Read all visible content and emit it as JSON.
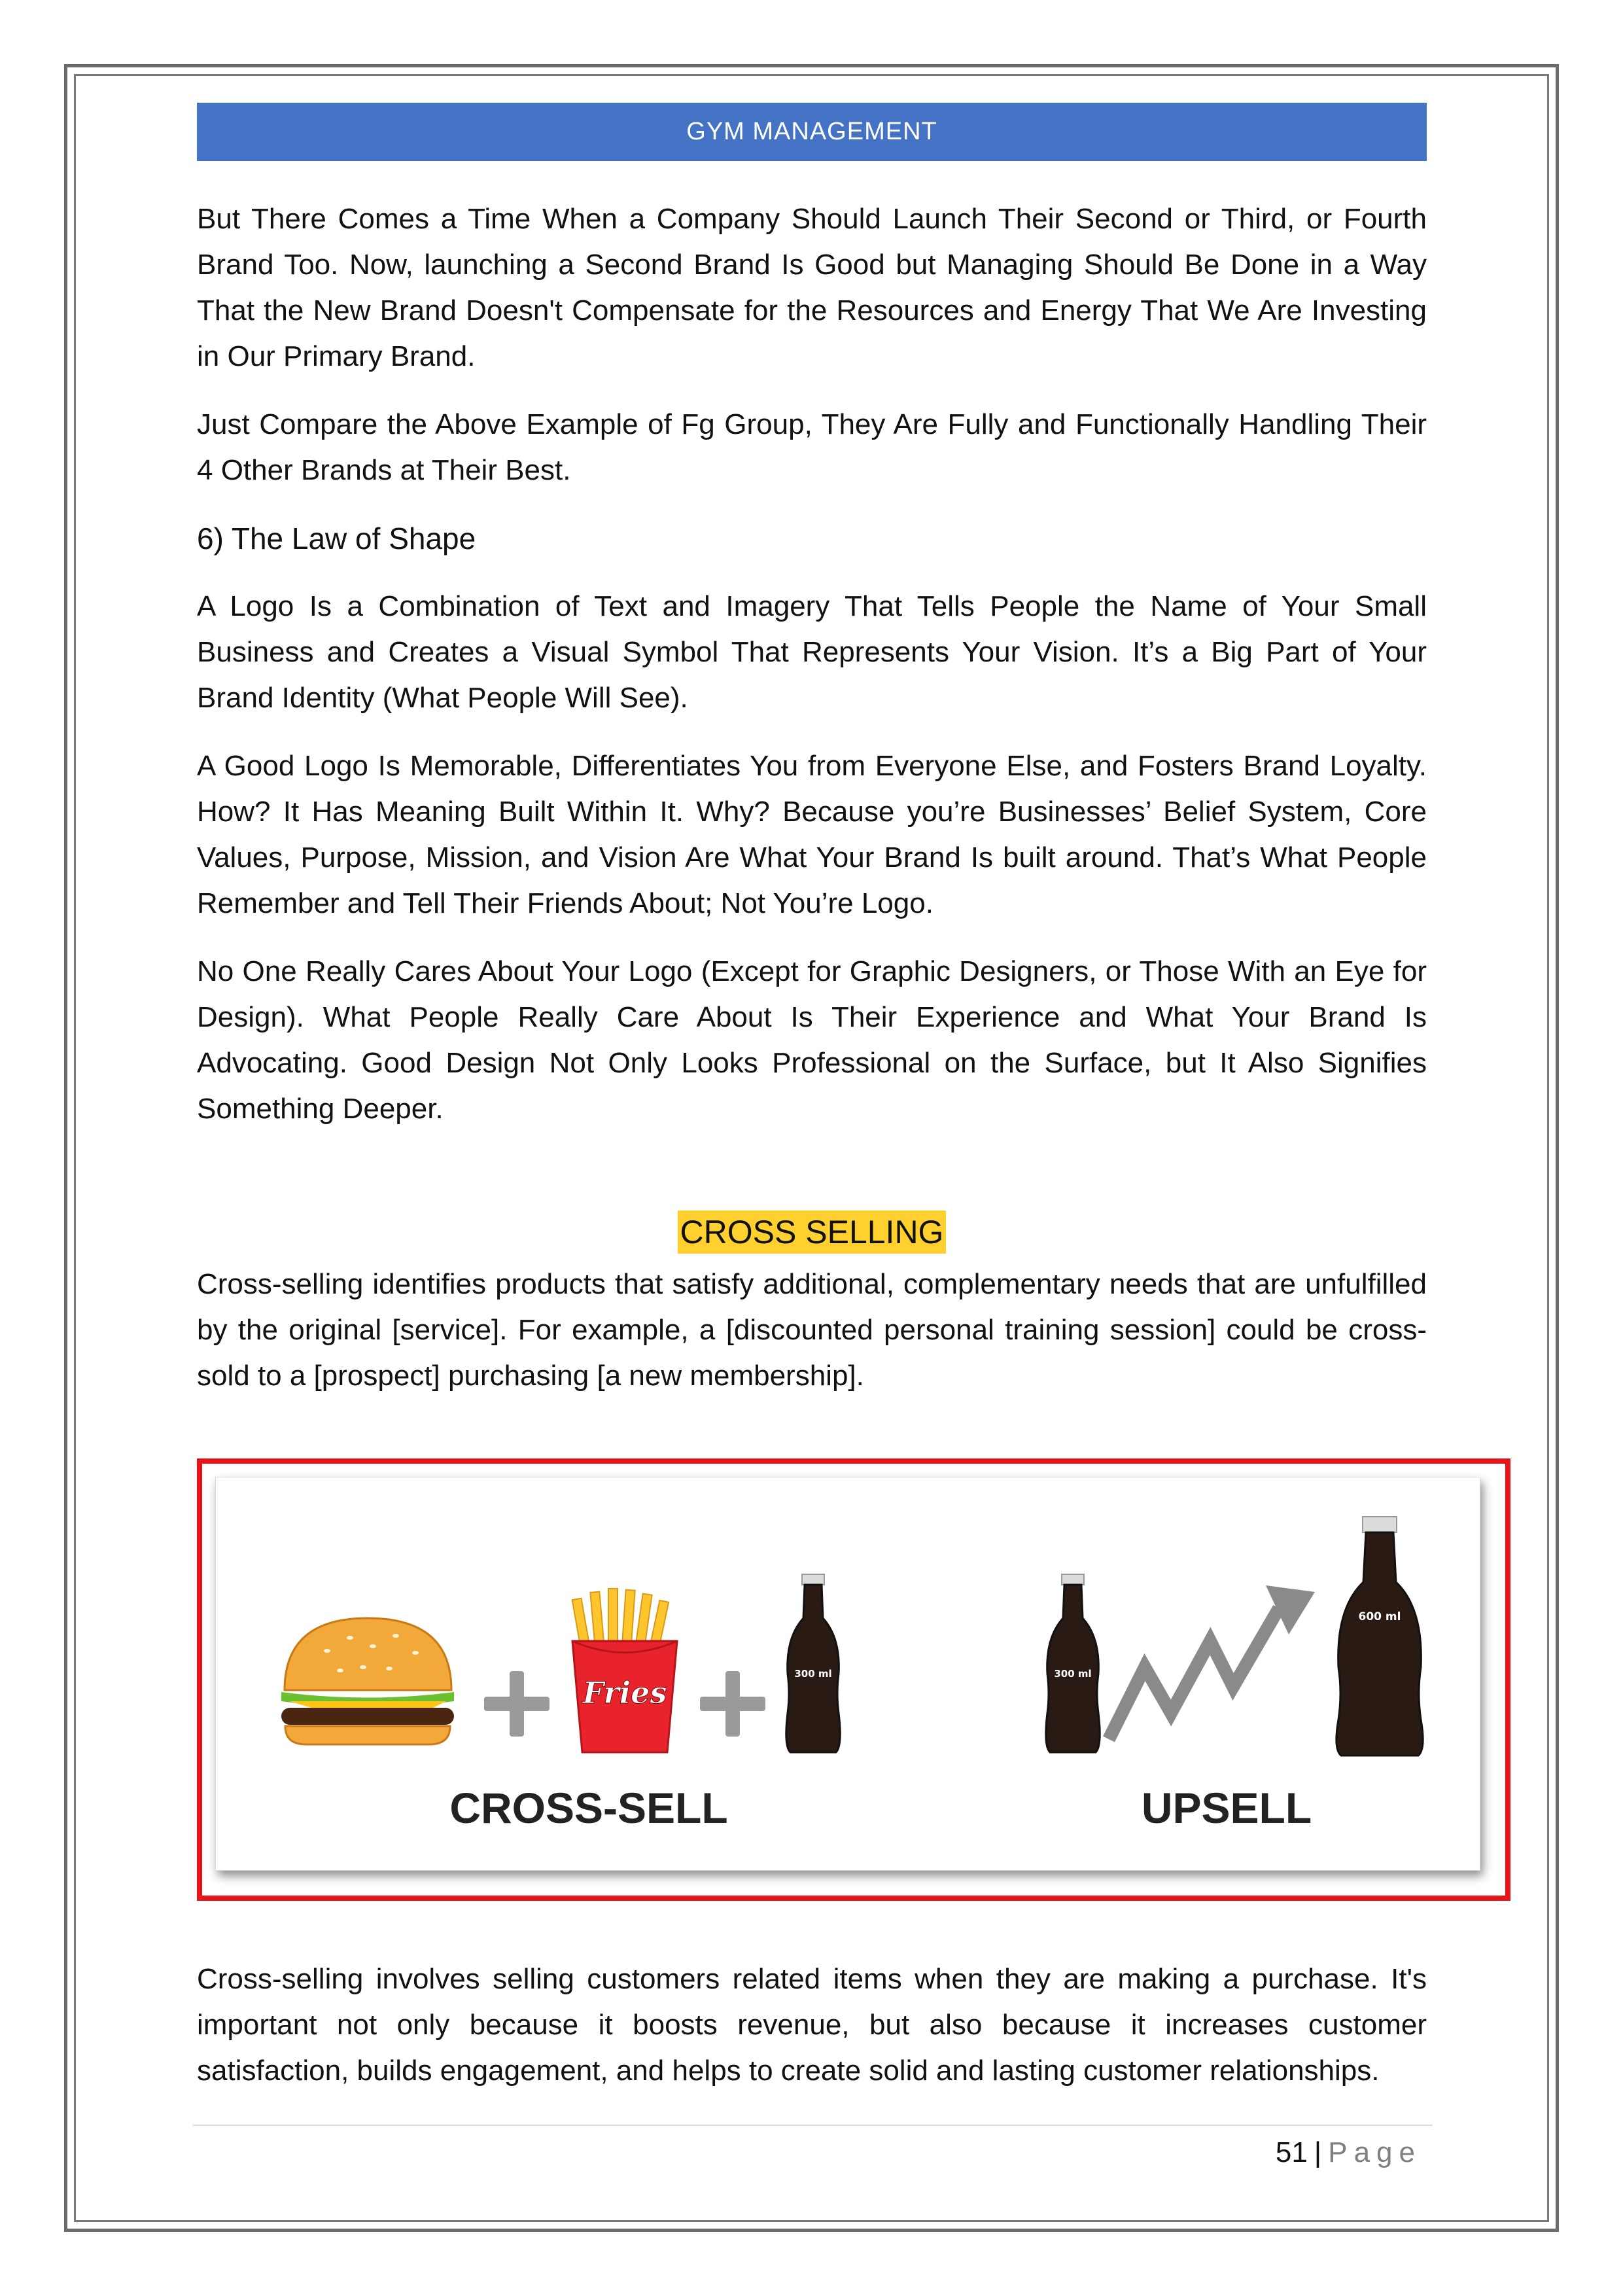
{
  "header": {
    "title": "GYM MANAGEMENT"
  },
  "paragraphs_top": [
    "But There Comes a Time When a Company Should Launch Their Second or Third, or Fourth Brand Too. Now, launching a Second Brand Is Good but Managing Should Be Done in a Way That the New Brand Doesn't Compensate for the Resources and Energy That We Are Investing in Our Primary Brand.",
    "Just Compare the Above Example of Fg Group, They Are Fully and Functionally Handling Their 4 Other Brands at Their Best."
  ],
  "subheading": "6) The Law of Shape",
  "paragraphs_shape": [
    "A Logo Is a Combination of Text and Imagery That Tells People the Name of Your Small Business and Creates a Visual Symbol That Represents Your Vision. It’s a Big Part of Your Brand Identity (What People Will See).",
    "A Good Logo Is Memorable, Differentiates You from Everyone Else, and Fosters Brand Loyalty. How? It Has Meaning Built Within It. Why? Because you’re Businesses’ Belief System, Core Values, Purpose, Mission, and Vision Are What Your Brand Is built around. That’s What People Remember and Tell Their Friends About; Not You’re Logo.",
    "No One Really Cares About Your Logo (Except for Graphic Designers, or Those With an Eye for Design). What People Really Care About Is Their Experience and What Your Brand Is Advocating. Good Design Not Only Looks Professional on the Surface, but It Also Signifies Something Deeper."
  ],
  "section_title": "CROSS SELLING",
  "cross_selling_intro": "Cross-selling identifies products that satisfy additional, complementary needs that are unfulfilled by the original [service]. For example, a [discounted personal training session] could be cross-sold to a [prospect] purchasing [a new membership].",
  "figure": {
    "fries_label": "Fries",
    "small_bottle_label": "300 ml",
    "large_bottle_label": "600 ml",
    "cross_sell_label": "CROSS-SELL",
    "upsell_label": "UPSELL",
    "frame_color": "#e8141a"
  },
  "cross_selling_body": "Cross-selling involves selling customers related items when they are making a purchase. It's important not only because it boosts revenue, but also because it increases customer satisfaction, builds engagement, and helps to create solid and lasting customer relationships.",
  "footer": {
    "page_number": "51",
    "separator": "|",
    "page_word": "Page"
  },
  "colors": {
    "header_bg": "#4472c4",
    "highlight": "#ffd02e"
  }
}
